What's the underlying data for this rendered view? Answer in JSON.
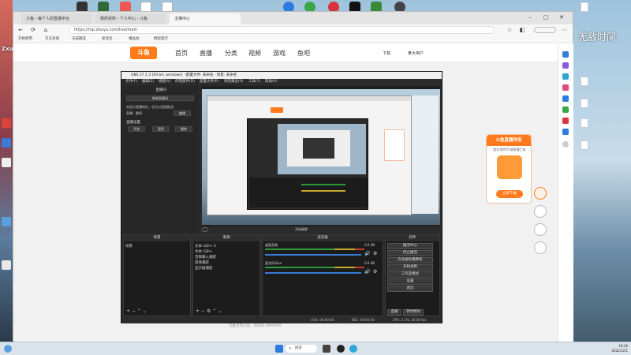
{
  "desktop": {
    "watermark_right": "无敌时间",
    "streamer_tag": "Zxuanhlq"
  },
  "browser": {
    "tabs": [
      {
        "label": "斗鱼 - 每个人的直播平台"
      },
      {
        "label": "我的资料 - 个人中心 - 斗鱼"
      },
      {
        "label": "主播中心"
      }
    ],
    "url": "https://mp.douyu.com/live/main",
    "favorites": [
      "开始使用",
      "京东商城",
      "天猫精选",
      "爱淘宝",
      "唯品会",
      "携程旅行"
    ],
    "site": {
      "logo_text": "斗鱼",
      "nav": [
        "首页",
        "直播",
        "分类",
        "视频",
        "游戏",
        "鱼吧"
      ],
      "download_label": "下载",
      "user_label": "某大用户"
    }
  },
  "obs": {
    "title": "OBS 27.1.3 (64 bit, windows) - 配置文件: 未命名 - 场景: 未命名",
    "menu": [
      "文件(F)",
      "编辑(E)",
      "视图(V)",
      "停靠部件(D)",
      "配置文件(P)",
      "场景集合(S)",
      "工具(T)",
      "帮助(H)"
    ],
    "left_panel": {
      "header": "直播间",
      "refresh_button": "刷新直播间",
      "lines": [
        "未显示直播地址，也可以直接推流",
        "直播：重鸣"
      ],
      "edit_button": "编辑",
      "section2_title": "直播设置",
      "buttons": [
        "开始",
        "暂停",
        "删除"
      ]
    },
    "preview_label": "开始录屏",
    "docks": {
      "scenes": {
        "title": "场景",
        "items": [
          "场景"
        ]
      },
      "sources": {
        "title": "来源",
        "items": [
          "文本 GDI+ 2",
          "文本 GDI+",
          "音频输入捕获",
          "游戏捕获",
          "显示器捕获"
        ]
      },
      "mixer": {
        "title": "混音器",
        "channels": [
          {
            "name": "桌面音频",
            "level": "0.0 dB"
          },
          {
            "name": "麦克风/Aux",
            "level": "0.0 dB"
          }
        ]
      },
      "controls": {
        "title": "控件",
        "buttons": [
          "推流中心",
          "停止推流",
          "启动虚拟摄像机",
          "开始录制",
          "工作室模式",
          "设置",
          "退出"
        ],
        "bottom": [
          "直播",
          "转场特效"
        ]
      }
    },
    "status": {
      "live": "LIVE: 00:00:00",
      "rec": "REC: 00:00:00",
      "cpu": "CPU: 2.1%, 30.00 fps"
    },
    "caption": "已推流到斗鱼，房间号 4890950"
  },
  "promo": {
    "title": "斗鱼直播伴侣",
    "subtitle": "超好用的PC端直播工具",
    "download_button": "立即下载"
  },
  "taskbar": {
    "search": "搜索",
    "time": "18:36",
    "date": "2022/12/1"
  }
}
